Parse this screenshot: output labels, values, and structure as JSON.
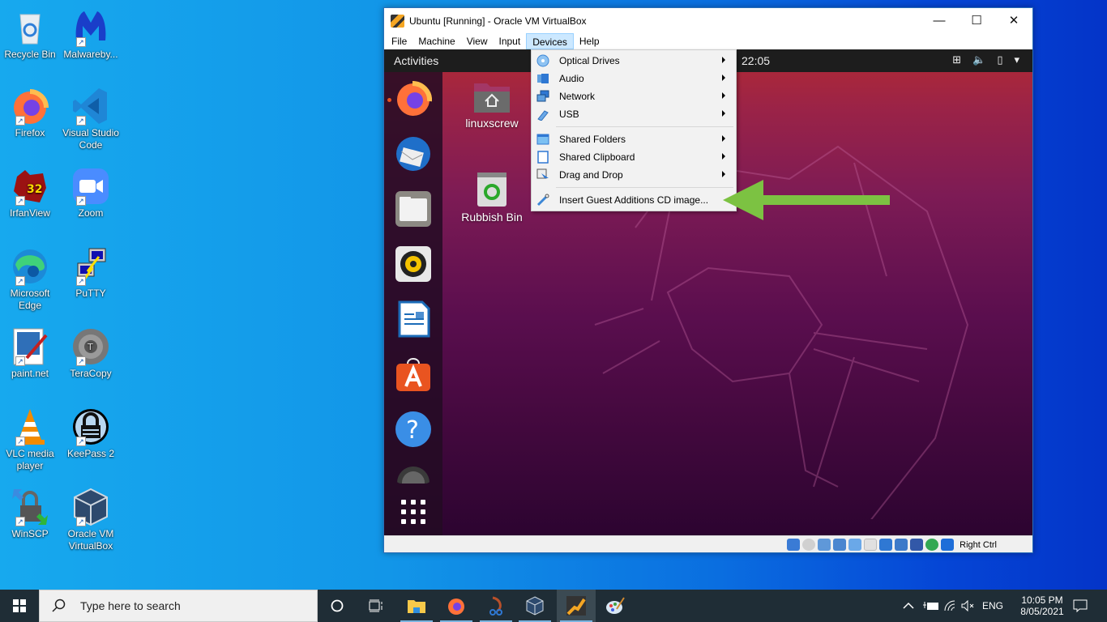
{
  "desktop": {
    "icons": [
      {
        "label": "Recycle Bin",
        "icon": "recycle-bin-icon"
      },
      {
        "label": "Malwareby...",
        "icon": "malwarebytes-icon"
      },
      {
        "label": "Firefox",
        "icon": "firefox-icon"
      },
      {
        "label": "Visual Studio Code",
        "icon": "vscode-icon"
      },
      {
        "label": "IrfanView",
        "icon": "irfanview-icon"
      },
      {
        "label": "Zoom",
        "icon": "zoom-icon"
      },
      {
        "label": "Microsoft Edge",
        "icon": "edge-icon"
      },
      {
        "label": "PuTTY",
        "icon": "putty-icon"
      },
      {
        "label": "paint.net",
        "icon": "paintnet-icon"
      },
      {
        "label": "TeraCopy",
        "icon": "teracopy-icon"
      },
      {
        "label": "VLC media player",
        "icon": "vlc-icon"
      },
      {
        "label": "KeePass 2",
        "icon": "keepass-icon"
      },
      {
        "label": "WinSCP",
        "icon": "winscp-icon"
      },
      {
        "label": "Oracle VM VirtualBox",
        "icon": "virtualbox-icon"
      }
    ]
  },
  "vbox": {
    "title": "Ubuntu [Running] - Oracle VM VirtualBox",
    "controls": {
      "minimize": "—",
      "maximize": "☐",
      "close": "✕"
    },
    "menubar": [
      "File",
      "Machine",
      "View",
      "Input",
      "Devices",
      "Help"
    ],
    "active_menu": "Devices",
    "devices_menu": [
      {
        "label": "Optical Drives",
        "icon": "optical-drive-icon",
        "submenu": true
      },
      {
        "label": "Audio",
        "icon": "audio-icon",
        "submenu": true
      },
      {
        "label": "Network",
        "icon": "network-icon",
        "submenu": true
      },
      {
        "label": "USB",
        "icon": "usb-icon",
        "submenu": true
      },
      {
        "label": "Shared Folders",
        "icon": "shared-folders-icon",
        "submenu": true
      },
      {
        "label": "Shared Clipboard",
        "icon": "shared-clipboard-icon",
        "submenu": true
      },
      {
        "label": "Drag and Drop",
        "icon": "drag-drop-icon",
        "submenu": true
      },
      {
        "label": "Insert Guest Additions CD image...",
        "icon": "guest-additions-icon",
        "submenu": false
      }
    ],
    "status_host_key": "Right Ctrl",
    "annotation_color": "#7cc242"
  },
  "guest": {
    "topbar": {
      "activities": "Activities",
      "clock": "22:05",
      "tray": [
        "network-icon",
        "volume-icon",
        "battery-icon",
        "menu-arrow-icon"
      ]
    },
    "dock": [
      "Firefox",
      "Thunderbird",
      "Files",
      "Rhythmbox",
      "LibreOffice Writer",
      "Ubuntu Software",
      "Help",
      "Optical Disc",
      "Show Applications"
    ],
    "desktop_items": [
      {
        "label": "linuxscrew",
        "icon": "home-folder-icon"
      },
      {
        "label": "Rubbish Bin",
        "icon": "trash-icon"
      }
    ]
  },
  "taskbar": {
    "search_placeholder": "Type here to search",
    "pinned": [
      "Cortana",
      "Task View",
      "File Explorer",
      "Firefox",
      "Snipping Tool",
      "Oracle VM VirtualBox",
      "VirtualBox VM",
      "Paint"
    ],
    "tray": {
      "language": "ENG",
      "time": "10:05 PM",
      "date": "8/05/2021"
    }
  }
}
